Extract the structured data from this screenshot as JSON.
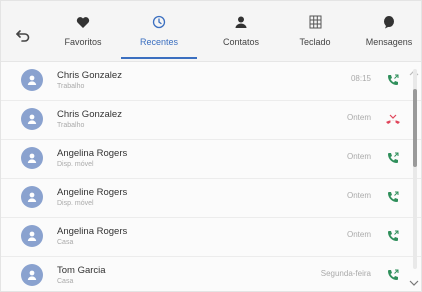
{
  "tabs": [
    {
      "label": "Favoritos",
      "icon": "heart-icon",
      "active": false
    },
    {
      "label": "Recentes",
      "icon": "clock-icon",
      "active": true
    },
    {
      "label": "Contatos",
      "icon": "person-icon",
      "active": false
    },
    {
      "label": "Teclado",
      "icon": "keypad-icon",
      "active": false
    },
    {
      "label": "Mensagens",
      "icon": "message-icon",
      "active": false
    }
  ],
  "recents": [
    {
      "name": "Chris Gonzalez",
      "type": "Trabalho",
      "time": "08:15",
      "call_status": "outgoing"
    },
    {
      "name": "Chris Gonzalez",
      "type": "Trabalho",
      "time": "Ontem",
      "call_status": "missed"
    },
    {
      "name": "Angelina Rogers",
      "type": "Disp. móvel",
      "time": "Ontem",
      "call_status": "outgoing"
    },
    {
      "name": "Angeline Rogers",
      "type": "Disp. móvel",
      "time": "Ontem",
      "call_status": "outgoing"
    },
    {
      "name": "Angelina Rogers",
      "type": "Casa",
      "time": "Ontem",
      "call_status": "outgoing"
    },
    {
      "name": "Tom Garcia",
      "type": "Casa",
      "time": "Segunda-feira",
      "call_status": "outgoing"
    }
  ],
  "colors": {
    "accent": "#3b6fc0",
    "call_green": "#2f8f5b",
    "call_missed": "#e0455a",
    "avatar": "#8aa2cf"
  }
}
